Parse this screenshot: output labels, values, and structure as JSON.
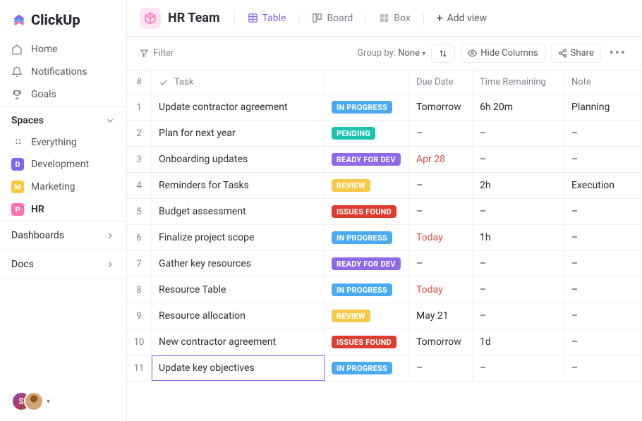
{
  "logo_text": "ClickUp",
  "nav": {
    "home": "Home",
    "notifications": "Notifications",
    "goals": "Goals"
  },
  "spaces": {
    "title": "Spaces",
    "everything": "Everything",
    "items": [
      {
        "letter": "D",
        "label": "Development"
      },
      {
        "letter": "M",
        "label": "Marketing"
      },
      {
        "letter": "P",
        "label": "HR"
      }
    ]
  },
  "links": {
    "dashboards": "Dashboards",
    "docs": "Docs"
  },
  "avatar_letter": "S",
  "team": {
    "title": "HR Team"
  },
  "views": {
    "table": "Table",
    "board": "Board",
    "box": "Box",
    "add": "Add view"
  },
  "toolbar": {
    "filter": "Filter",
    "groupby_label": "Group by:",
    "groupby_value": "None",
    "hide_columns": "Hide Columns",
    "share": "Share"
  },
  "columns": {
    "num": "#",
    "task": "Task",
    "due": "Due Date",
    "time": "Time Remaining",
    "note": "Note"
  },
  "status_labels": {
    "inprogress": "IN PROGRESS",
    "pending": "PENDING",
    "readydev": "READY FOR DEV",
    "review": "REVIEW",
    "issues": "ISSUES FOUND"
  },
  "rows": [
    {
      "n": "1",
      "task": "Update contractor agreement",
      "status": "inprogress",
      "due": "Tomorrow",
      "due_class": "",
      "time": "6h 20m",
      "note": "Planning"
    },
    {
      "n": "2",
      "task": "Plan for next year",
      "status": "pending",
      "due": "–",
      "due_class": "",
      "time": "–",
      "note": "–"
    },
    {
      "n": "3",
      "task": "Onboarding updates",
      "status": "readydev",
      "due": "Apr 28",
      "due_class": "due-soon",
      "time": "–",
      "note": "–"
    },
    {
      "n": "4",
      "task": "Reminders for Tasks",
      "status": "review",
      "due": "–",
      "due_class": "",
      "time": "2h",
      "note": "Execution"
    },
    {
      "n": "5",
      "task": "Budget assessment",
      "status": "issues",
      "due": "–",
      "due_class": "",
      "time": "–",
      "note": "–"
    },
    {
      "n": "6",
      "task": "Finalize project scope",
      "status": "inprogress",
      "due": "Today",
      "due_class": "due-today",
      "time": "1h",
      "note": "–"
    },
    {
      "n": "7",
      "task": "Gather key resources",
      "status": "readydev",
      "due": "–",
      "due_class": "",
      "time": "–",
      "note": "–"
    },
    {
      "n": "8",
      "task": "Resource Table",
      "status": "inprogress",
      "due": "Today",
      "due_class": "due-today",
      "time": "–",
      "note": "–"
    },
    {
      "n": "9",
      "task": "Resource allocation",
      "status": "review",
      "due": "May 21",
      "due_class": "",
      "time": "–",
      "note": "–"
    },
    {
      "n": "10",
      "task": "New contractor agreement",
      "status": "issues",
      "due": "Tomorrow",
      "due_class": "",
      "time": "1d",
      "note": "–"
    },
    {
      "n": "11",
      "task": "Update key objectives",
      "status": "inprogress",
      "due": "–",
      "due_class": "",
      "time": "–",
      "note": "–"
    }
  ],
  "selected_row": "11"
}
